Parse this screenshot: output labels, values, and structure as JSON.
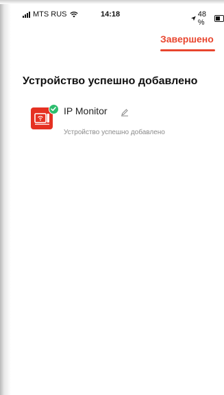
{
  "status_bar": {
    "carrier": "MTS RUS",
    "time": "14:18",
    "battery": "48 %",
    "icons": [
      "signal-icon",
      "wifi-icon",
      "location-arrow-icon",
      "battery-icon"
    ]
  },
  "header": {
    "done_label": "Завершено"
  },
  "main": {
    "title": "Устройство успешно добавлено",
    "device": {
      "name": "IP Monitor",
      "status": "Устройство успешно добавлено",
      "icon": "ip-monitor-icon",
      "badge_icon": "check-badge-icon",
      "edit_icon": "pencil-icon"
    }
  },
  "colors": {
    "accent": "#e8452e",
    "device_icon_bg": "#e53122",
    "success": "#2dbd6e"
  }
}
